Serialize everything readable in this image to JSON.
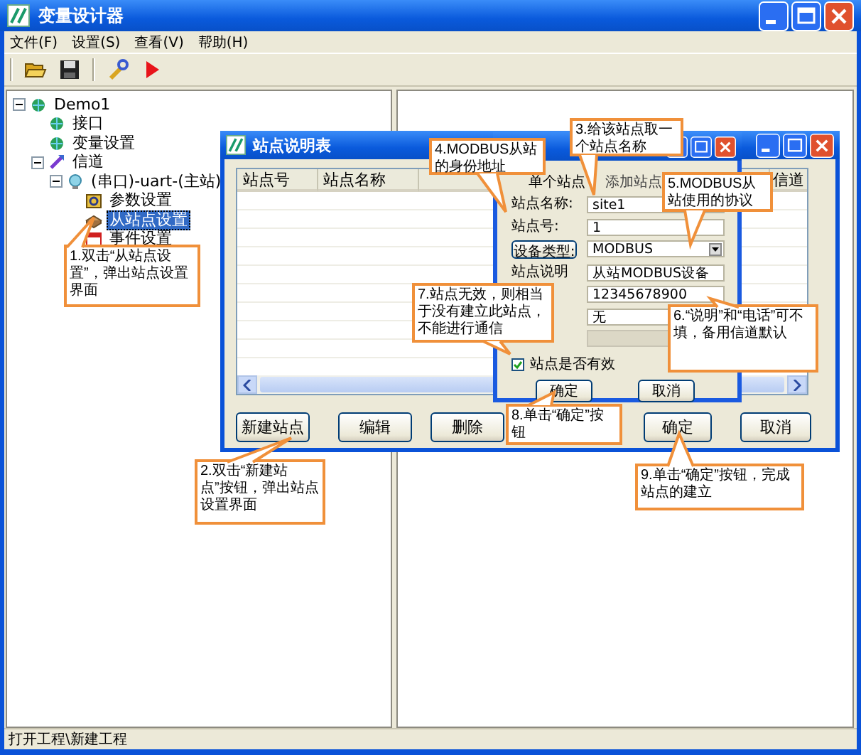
{
  "window": {
    "title": "变量设计器"
  },
  "menu": [
    "文件(F)",
    "设置(S)",
    "查看(V)",
    "帮助(H)"
  ],
  "toolbar": [
    {
      "kind": "open"
    },
    {
      "kind": "save"
    },
    {
      "kind": "tools"
    },
    {
      "kind": "run"
    }
  ],
  "tree": [
    {
      "label": "Demo1",
      "kind": "net",
      "expanded": true,
      "selected": false,
      "children": [
        {
          "label": "接口",
          "kind": "net",
          "selected": false
        },
        {
          "label": "变量设置",
          "kind": "net",
          "selected": false
        },
        {
          "label": "信道",
          "kind": "channel",
          "expanded": true,
          "selected": false,
          "children": [
            {
              "label": "(串口)-uart-(主站)",
              "kind": "port",
              "expanded": true,
              "selected": false,
              "children": [
                {
                  "label": "参数设置",
                  "kind": "param",
                  "selected": false
                },
                {
                  "label": "从站点设置",
                  "kind": "station",
                  "selected": true
                },
                {
                  "label": "事件设置",
                  "kind": "event",
                  "selected": false
                }
              ]
            }
          ]
        }
      ]
    }
  ],
  "station_list_dialog": {
    "title": "站点说明表",
    "columns": [
      "站点号",
      "站点名称",
      "信道"
    ],
    "buttons": [
      "新建站点",
      "编辑",
      "删除",
      "确定",
      "取消"
    ]
  },
  "station_input_dialog": {
    "tabs": [
      {
        "label": "单个站点",
        "selected": true
      },
      {
        "label": "添加站点",
        "selected": false
      }
    ],
    "fields": [
      {
        "label": "站点名称:",
        "kind": "text",
        "value": "site1",
        "disabled": false
      },
      {
        "label": "站点号:",
        "kind": "text",
        "value": "1",
        "disabled": false
      },
      {
        "label": "设备类型:",
        "kind": "select",
        "value": "MODBUS",
        "disabled": false
      },
      {
        "label": "站点说明",
        "kind": "text",
        "value": "从站MODBUS设备",
        "disabled": false
      },
      {
        "kind": "text",
        "value": "12345678900",
        "disabled": false
      },
      {
        "kind": "text",
        "value": "无",
        "disabled": false
      },
      {
        "kind": "text",
        "disabled": true
      }
    ],
    "checkbox": {
      "label": "站点是否有效",
      "checked": true
    },
    "buttons": [
      "确定",
      "取消"
    ]
  },
  "callouts": [
    "1.双击“从站点设置”，弹出站点设置界面",
    "2.双击“新建站点”按钮，弹出站点设置界面",
    "3.给该站点取一个站点名称",
    "4.MODBUS从站的身份地址",
    "5.MODBUS从站使用的协议",
    "7.站点无效，则相当于没有建立此站点，不能进行通信",
    "6.“说明”和“电话”可不填，备用信道默认",
    "8.单击“确定”按钮",
    "9.单击“确定”按钮，完成站点的建立"
  ],
  "status_bar": "打开工程\\新建工程"
}
